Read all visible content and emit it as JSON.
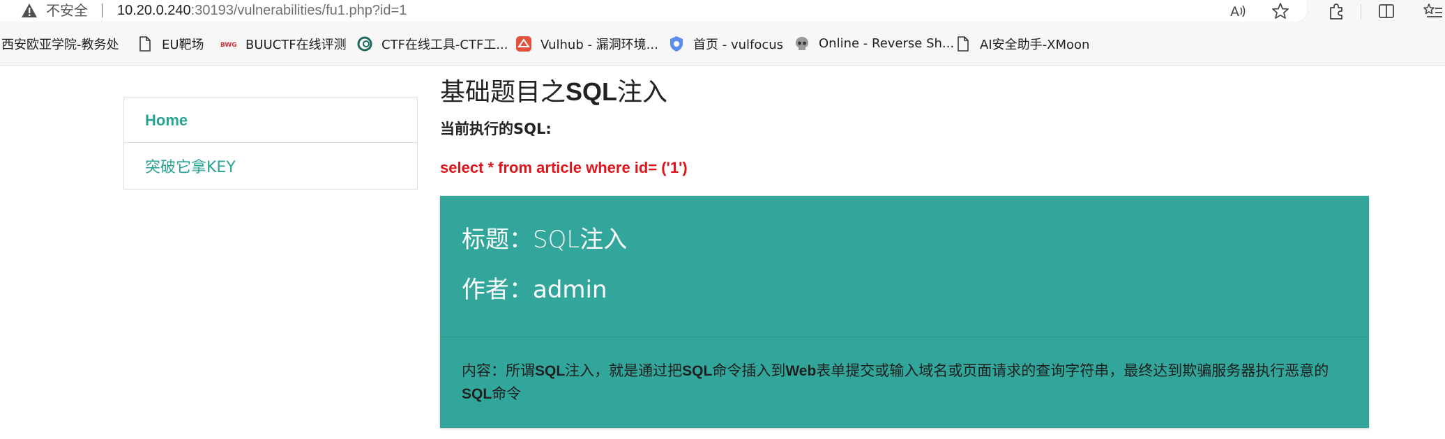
{
  "browser": {
    "security_label": "不安全",
    "url_host": "10.20.0.240",
    "url_path": ":30193/vulnerabilities/fu1.php?id=1",
    "icons": [
      "read-aloud-icon",
      "favorite-star-icon",
      "extensions-icon",
      "split-screen-icon",
      "favorites-list-icon"
    ]
  },
  "bookmarks": [
    {
      "label": "西安欧亚学院-教务处",
      "icon": "none"
    },
    {
      "label": "EU靶场",
      "icon": "page-icon"
    },
    {
      "label": "BUUCTF在线评测",
      "icon": "buuctf-logo-icon"
    },
    {
      "label": "CTF在线工具-CTF工...",
      "icon": "ctf-tools-logo-icon"
    },
    {
      "label": "Vulhub - 漏洞环境...",
      "icon": "vulhub-logo-icon"
    },
    {
      "label": "首页 - vulfocus",
      "icon": "vulfocus-logo-icon"
    },
    {
      "label": "Online - Reverse Sh...",
      "icon": "skull-icon"
    },
    {
      "label": "AI安全助手-XMoon",
      "icon": "page-icon"
    }
  ],
  "sidebar": {
    "items": [
      {
        "label": "Home"
      },
      {
        "label": "突破它拿KEY"
      }
    ]
  },
  "main": {
    "title_prefix": "基础题目之",
    "title_sql": "SQL",
    "title_suffix": "注入",
    "sql_label": "当前执行的SQL:",
    "sql_query": "select * from article where id= ('1')"
  },
  "article": {
    "title_label": "标题：",
    "title_value": "SQL注入",
    "author_label": "作者：",
    "author_value": "admin",
    "content_label": "内容：",
    "content_parts": [
      {
        "text": "所谓",
        "bold": false
      },
      {
        "text": "SQL",
        "bold": true
      },
      {
        "text": "注入，就是通过把",
        "bold": false
      },
      {
        "text": "SQL",
        "bold": true
      },
      {
        "text": "命令插入到",
        "bold": false
      },
      {
        "text": "Web",
        "bold": true
      },
      {
        "text": "表单提交或输入域名或页面请求的查询字符串，最终达到欺骗服务器执行恶意的",
        "bold": false
      },
      {
        "text": "SQL",
        "bold": true
      },
      {
        "text": "命令",
        "bold": false
      }
    ]
  },
  "colors": {
    "accent": "#2aa394",
    "card_bg": "#32a69a",
    "sql_red": "#e0141b"
  }
}
